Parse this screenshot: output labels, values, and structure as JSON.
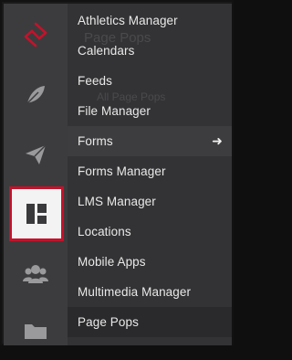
{
  "brand": {
    "accent_color": "#c4122b",
    "logo_icon": "diamond-logo-icon"
  },
  "rail": {
    "items": [
      {
        "icon": "feather-icon",
        "active": false
      },
      {
        "icon": "paper-plane-icon",
        "active": false
      },
      {
        "icon": "dashboard-layout-icon",
        "active": true
      },
      {
        "icon": "users-group-icon",
        "active": false
      },
      {
        "icon": "folder-icon",
        "active": false
      }
    ]
  },
  "background": {
    "ghost_title": "Page Pops",
    "ghost_subtitle": "All Page Pops"
  },
  "menu": {
    "items": [
      {
        "label": "Athletics Manager"
      },
      {
        "label": "Calendars"
      },
      {
        "label": "Feeds"
      },
      {
        "label": "File Manager"
      },
      {
        "label": "Forms",
        "has_arrow": true,
        "arrow": "➜"
      },
      {
        "label": "Forms Manager"
      },
      {
        "label": "LMS Manager"
      },
      {
        "label": "Locations"
      },
      {
        "label": "Mobile Apps"
      },
      {
        "label": "Multimedia Manager"
      },
      {
        "label": "Page Pops"
      }
    ]
  }
}
